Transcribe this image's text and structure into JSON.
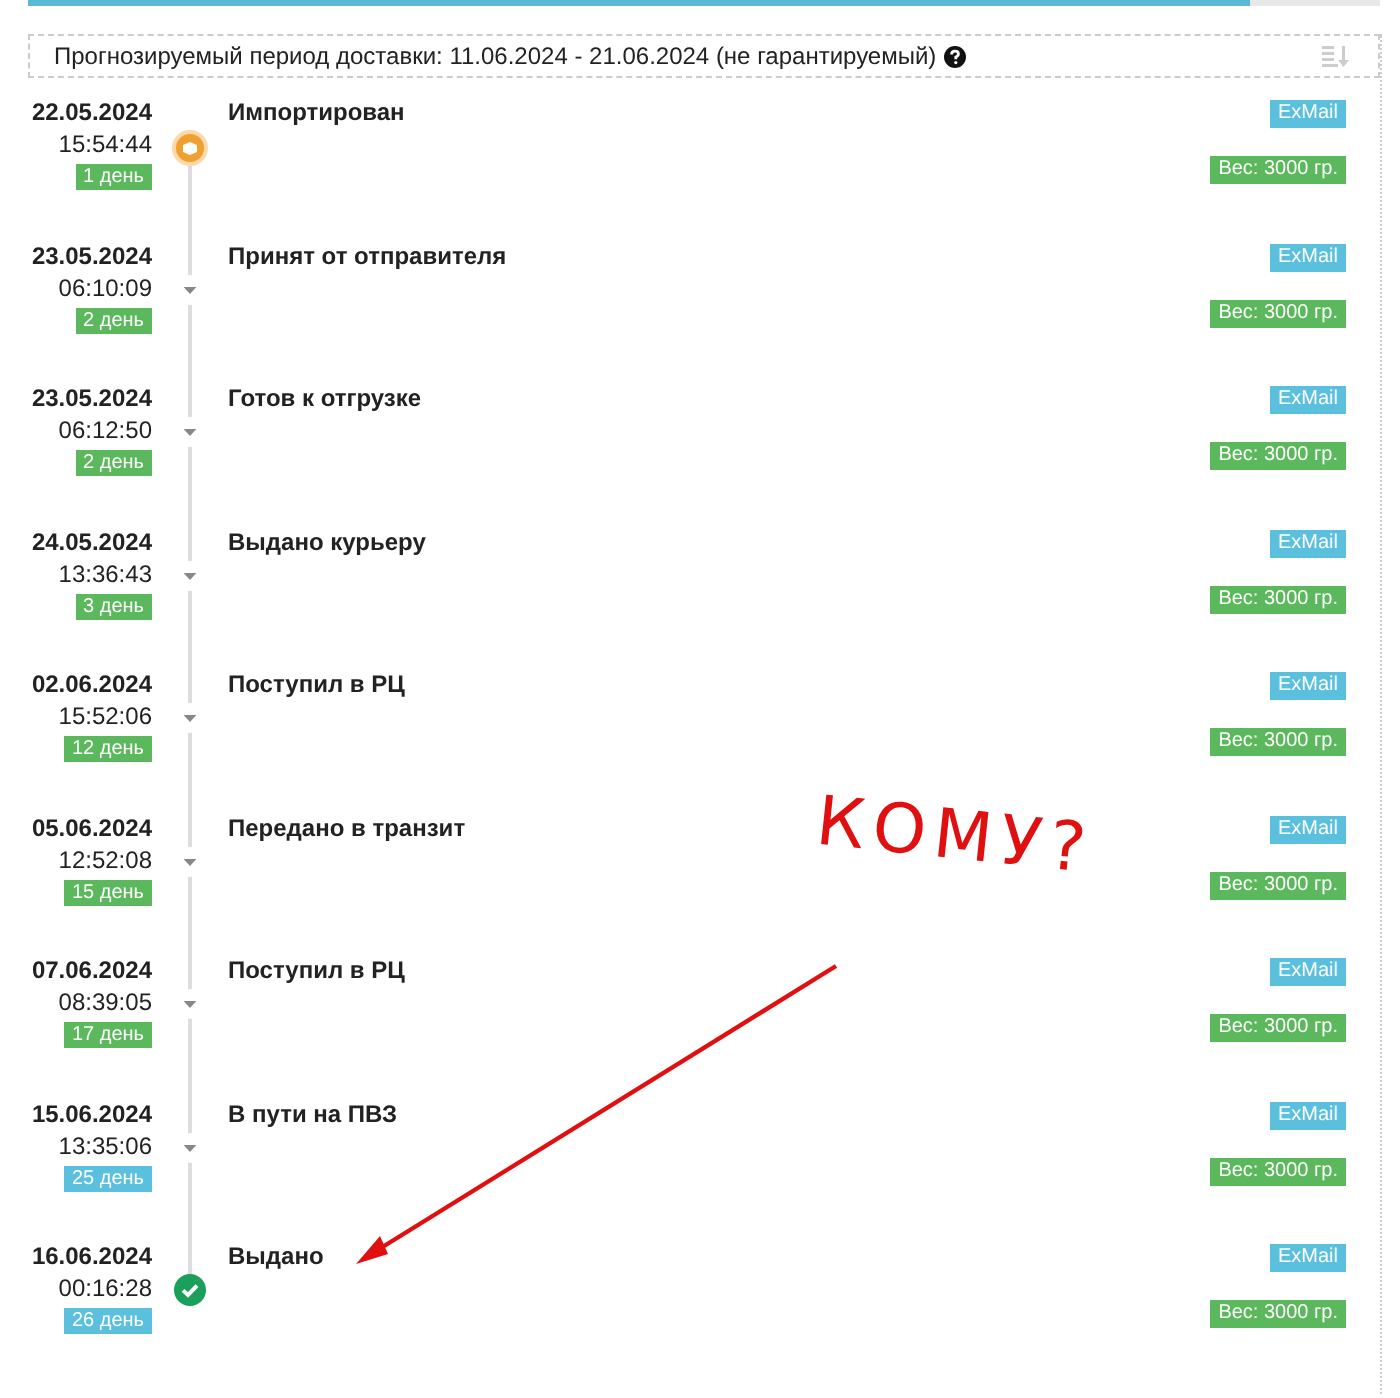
{
  "forecast": {
    "text": "Прогнозируемый период доставки: 11.06.2024 - 21.06.2024 (не гарантируемый)"
  },
  "events": [
    {
      "date": "22.05.2024",
      "time": "15:54:44",
      "days": "1 день",
      "color": "#5cb85c",
      "kind": "imported",
      "status": "Импортирован",
      "carrier": "ExMail",
      "weight": "Вес: 3000 гр."
    },
    {
      "date": "23.05.2024",
      "time": "06:10:09",
      "days": "2 день",
      "color": "#5cb85c",
      "kind": "step",
      "status": "Принят от отправителя",
      "carrier": "ExMail",
      "weight": "Вес: 3000 гр."
    },
    {
      "date": "23.05.2024",
      "time": "06:12:50",
      "days": "2 день",
      "color": "#5cb85c",
      "kind": "step",
      "status": "Готов к отгрузке",
      "carrier": "ExMail",
      "weight": "Вес: 3000 гр."
    },
    {
      "date": "24.05.2024",
      "time": "13:36:43",
      "days": "3 день",
      "color": "#5cb85c",
      "kind": "step",
      "status": "Выдано курьеру",
      "carrier": "ExMail",
      "weight": "Вес: 3000 гр."
    },
    {
      "date": "02.06.2024",
      "time": "15:52:06",
      "days": "12 день",
      "color": "#5cb85c",
      "kind": "step",
      "status": "Поступил в РЦ",
      "carrier": "ExMail",
      "weight": "Вес: 3000 гр."
    },
    {
      "date": "05.06.2024",
      "time": "12:52:08",
      "days": "15 день",
      "color": "#5cb85c",
      "kind": "step",
      "status": "Передано в транзит",
      "carrier": "ExMail",
      "weight": "Вес: 3000 гр."
    },
    {
      "date": "07.06.2024",
      "time": "08:39:05",
      "days": "17 день",
      "color": "#5cb85c",
      "kind": "step",
      "status": "Поступил в РЦ",
      "carrier": "ExMail",
      "weight": "Вес: 3000 гр."
    },
    {
      "date": "15.06.2024",
      "time": "13:35:06",
      "days": "25 день",
      "color": "#5bc0de",
      "kind": "step",
      "status": "В пути на ПВЗ",
      "carrier": "ExMail",
      "weight": "Вес: 3000 гр."
    },
    {
      "date": "16.06.2024",
      "time": "00:16:28",
      "days": "26 день",
      "color": "#5bc0de",
      "kind": "delivered",
      "status": "Выдано",
      "carrier": "ExMail",
      "weight": "Вес: 3000 гр."
    }
  ],
  "annotation": {
    "text": "КОМУ?"
  }
}
